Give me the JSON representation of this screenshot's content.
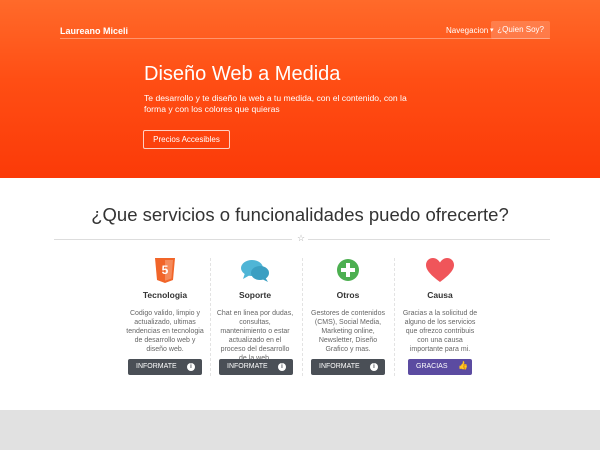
{
  "nav": {
    "brand": "Laureano Miceli",
    "dropdown": "Navegacion",
    "who": "¿Quien Soy?"
  },
  "hero": {
    "title": "Diseño Web a Medida",
    "text": "Te desarrollo y te diseño la web a tu medida, con el contenido, con la forma y con los colores que quieras",
    "button": "Precios Accesibles"
  },
  "services": {
    "title": "¿Que servicios o funcionalidades puedo ofrecerte?",
    "items": [
      {
        "icon": "html5-icon",
        "title": "Tecnologia",
        "text": "Codigo valido, limpio y actualizado, ultimas tendencias en tecnologia de desarrollo web y diseño web.",
        "button": "INFORMATE"
      },
      {
        "icon": "chat-bubbles-icon",
        "title": "Soporte",
        "text": "Chat en linea por dudas, consultas, mantenimiento o estar actualizado en el proceso del desarrollo de la web.",
        "button": "INFORMATE"
      },
      {
        "icon": "plus-circle-icon",
        "title": "Otros",
        "text": "Gestores de contenidos (CMS), Social Media, Marketing online, Newsletter, Diseño Grafico y mas.",
        "button": "INFORMATE"
      },
      {
        "icon": "heart-icon",
        "title": "Causa",
        "text": "Gracias a la solicitud de alguno de los servicios que ofrezco contribuis con una causa importante para mi.",
        "button": "GRACIAS"
      }
    ]
  },
  "colors": {
    "hero_top": "#ff6a2a",
    "hero_bottom": "#fb3a08",
    "html5": "#f16529",
    "chat": "#4fb5d6",
    "plus": "#4caf50",
    "heart": "#f0555a",
    "button_dark": "#4a4f56",
    "button_purple": "#5b4ba1"
  }
}
